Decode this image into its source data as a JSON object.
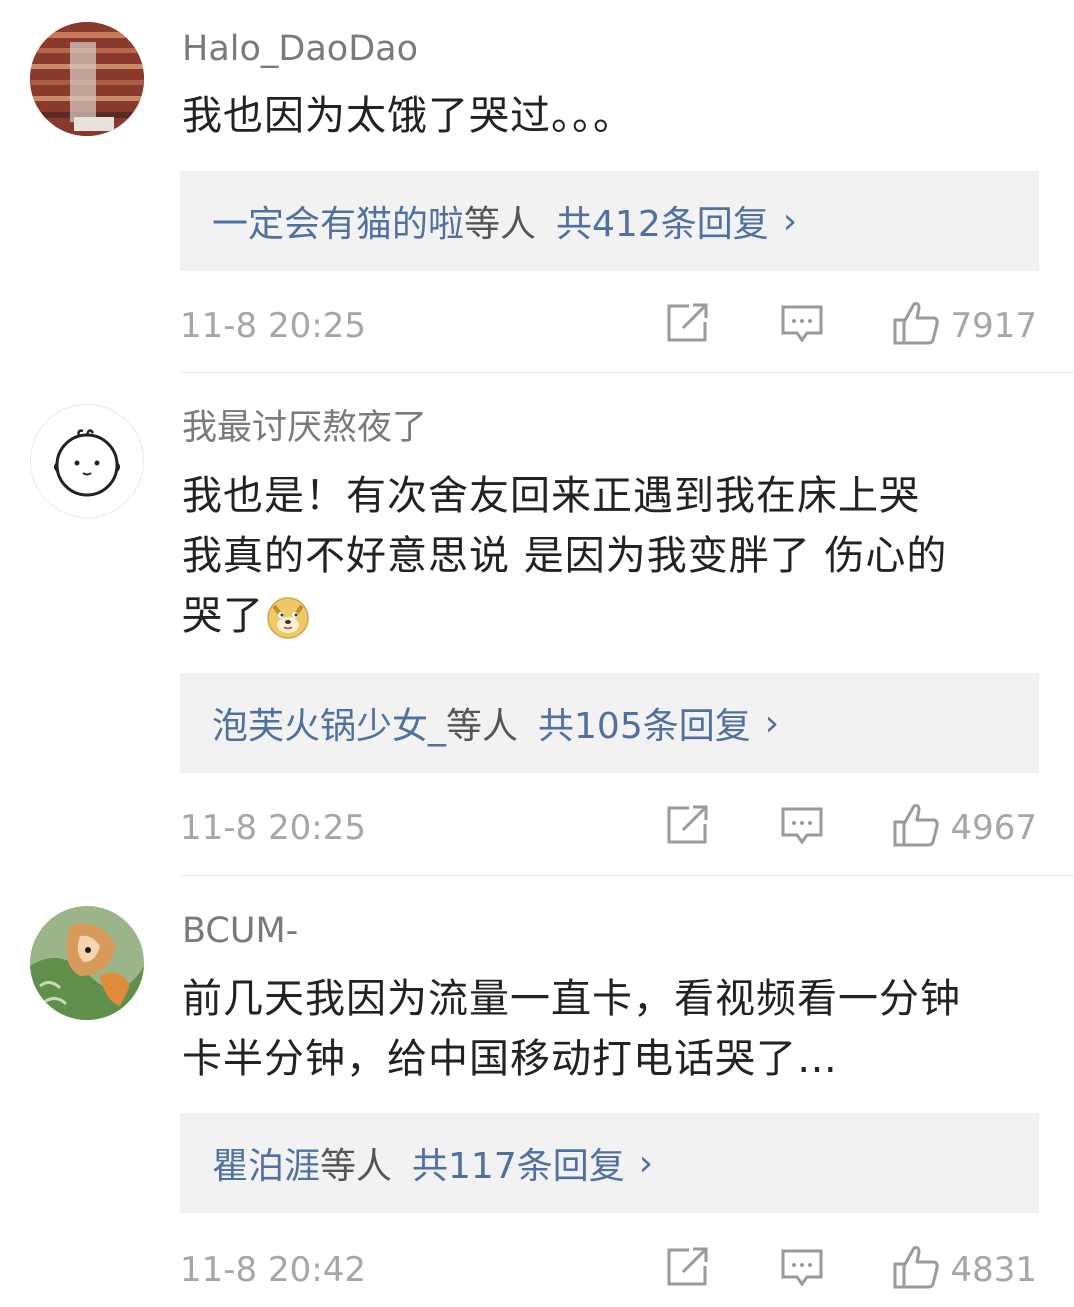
{
  "comments": [
    {
      "username": "Halo_DaoDao",
      "text_lines": [
        "我也因为太饿了哭过。。。"
      ],
      "replies": {
        "names": "一定会有猫的啦",
        "suffix": "等人",
        "total": "共412条回复",
        "chevron": "›"
      },
      "time": "11-8 20:25",
      "likes": "7917"
    },
    {
      "username": "我最讨厌熬夜了",
      "text_lines": [
        "我也是！有次舍友回来正遇到我在床上哭",
        "我真的不好意思说 是因为我变胖了 伤心的",
        "哭了"
      ],
      "replies": {
        "names": "泡芙火锅少女_",
        "suffix": "等人",
        "total": "共105条回复",
        "chevron": "›"
      },
      "time": "11-8 20:25",
      "likes": "4967"
    },
    {
      "username": "BCUM-",
      "text_lines": [
        "前几天我因为流量一直卡，看视频看一分钟",
        "卡半分钟，给中国移动打电话哭了…"
      ],
      "replies": {
        "names": "瞿泊涯",
        "suffix": "等人",
        "total": "共117条回复",
        "chevron": "›"
      },
      "time": "11-8 20:42",
      "likes": "4831"
    }
  ],
  "icons": {
    "share": "share-icon",
    "reply": "comment-icon",
    "like": "thumbs-up-icon",
    "emoji": "doge-emoji-icon"
  },
  "colors": {
    "link": "#50709e",
    "meta": "#a6a6a6",
    "reply_box_bg": "#f2f2f2"
  }
}
